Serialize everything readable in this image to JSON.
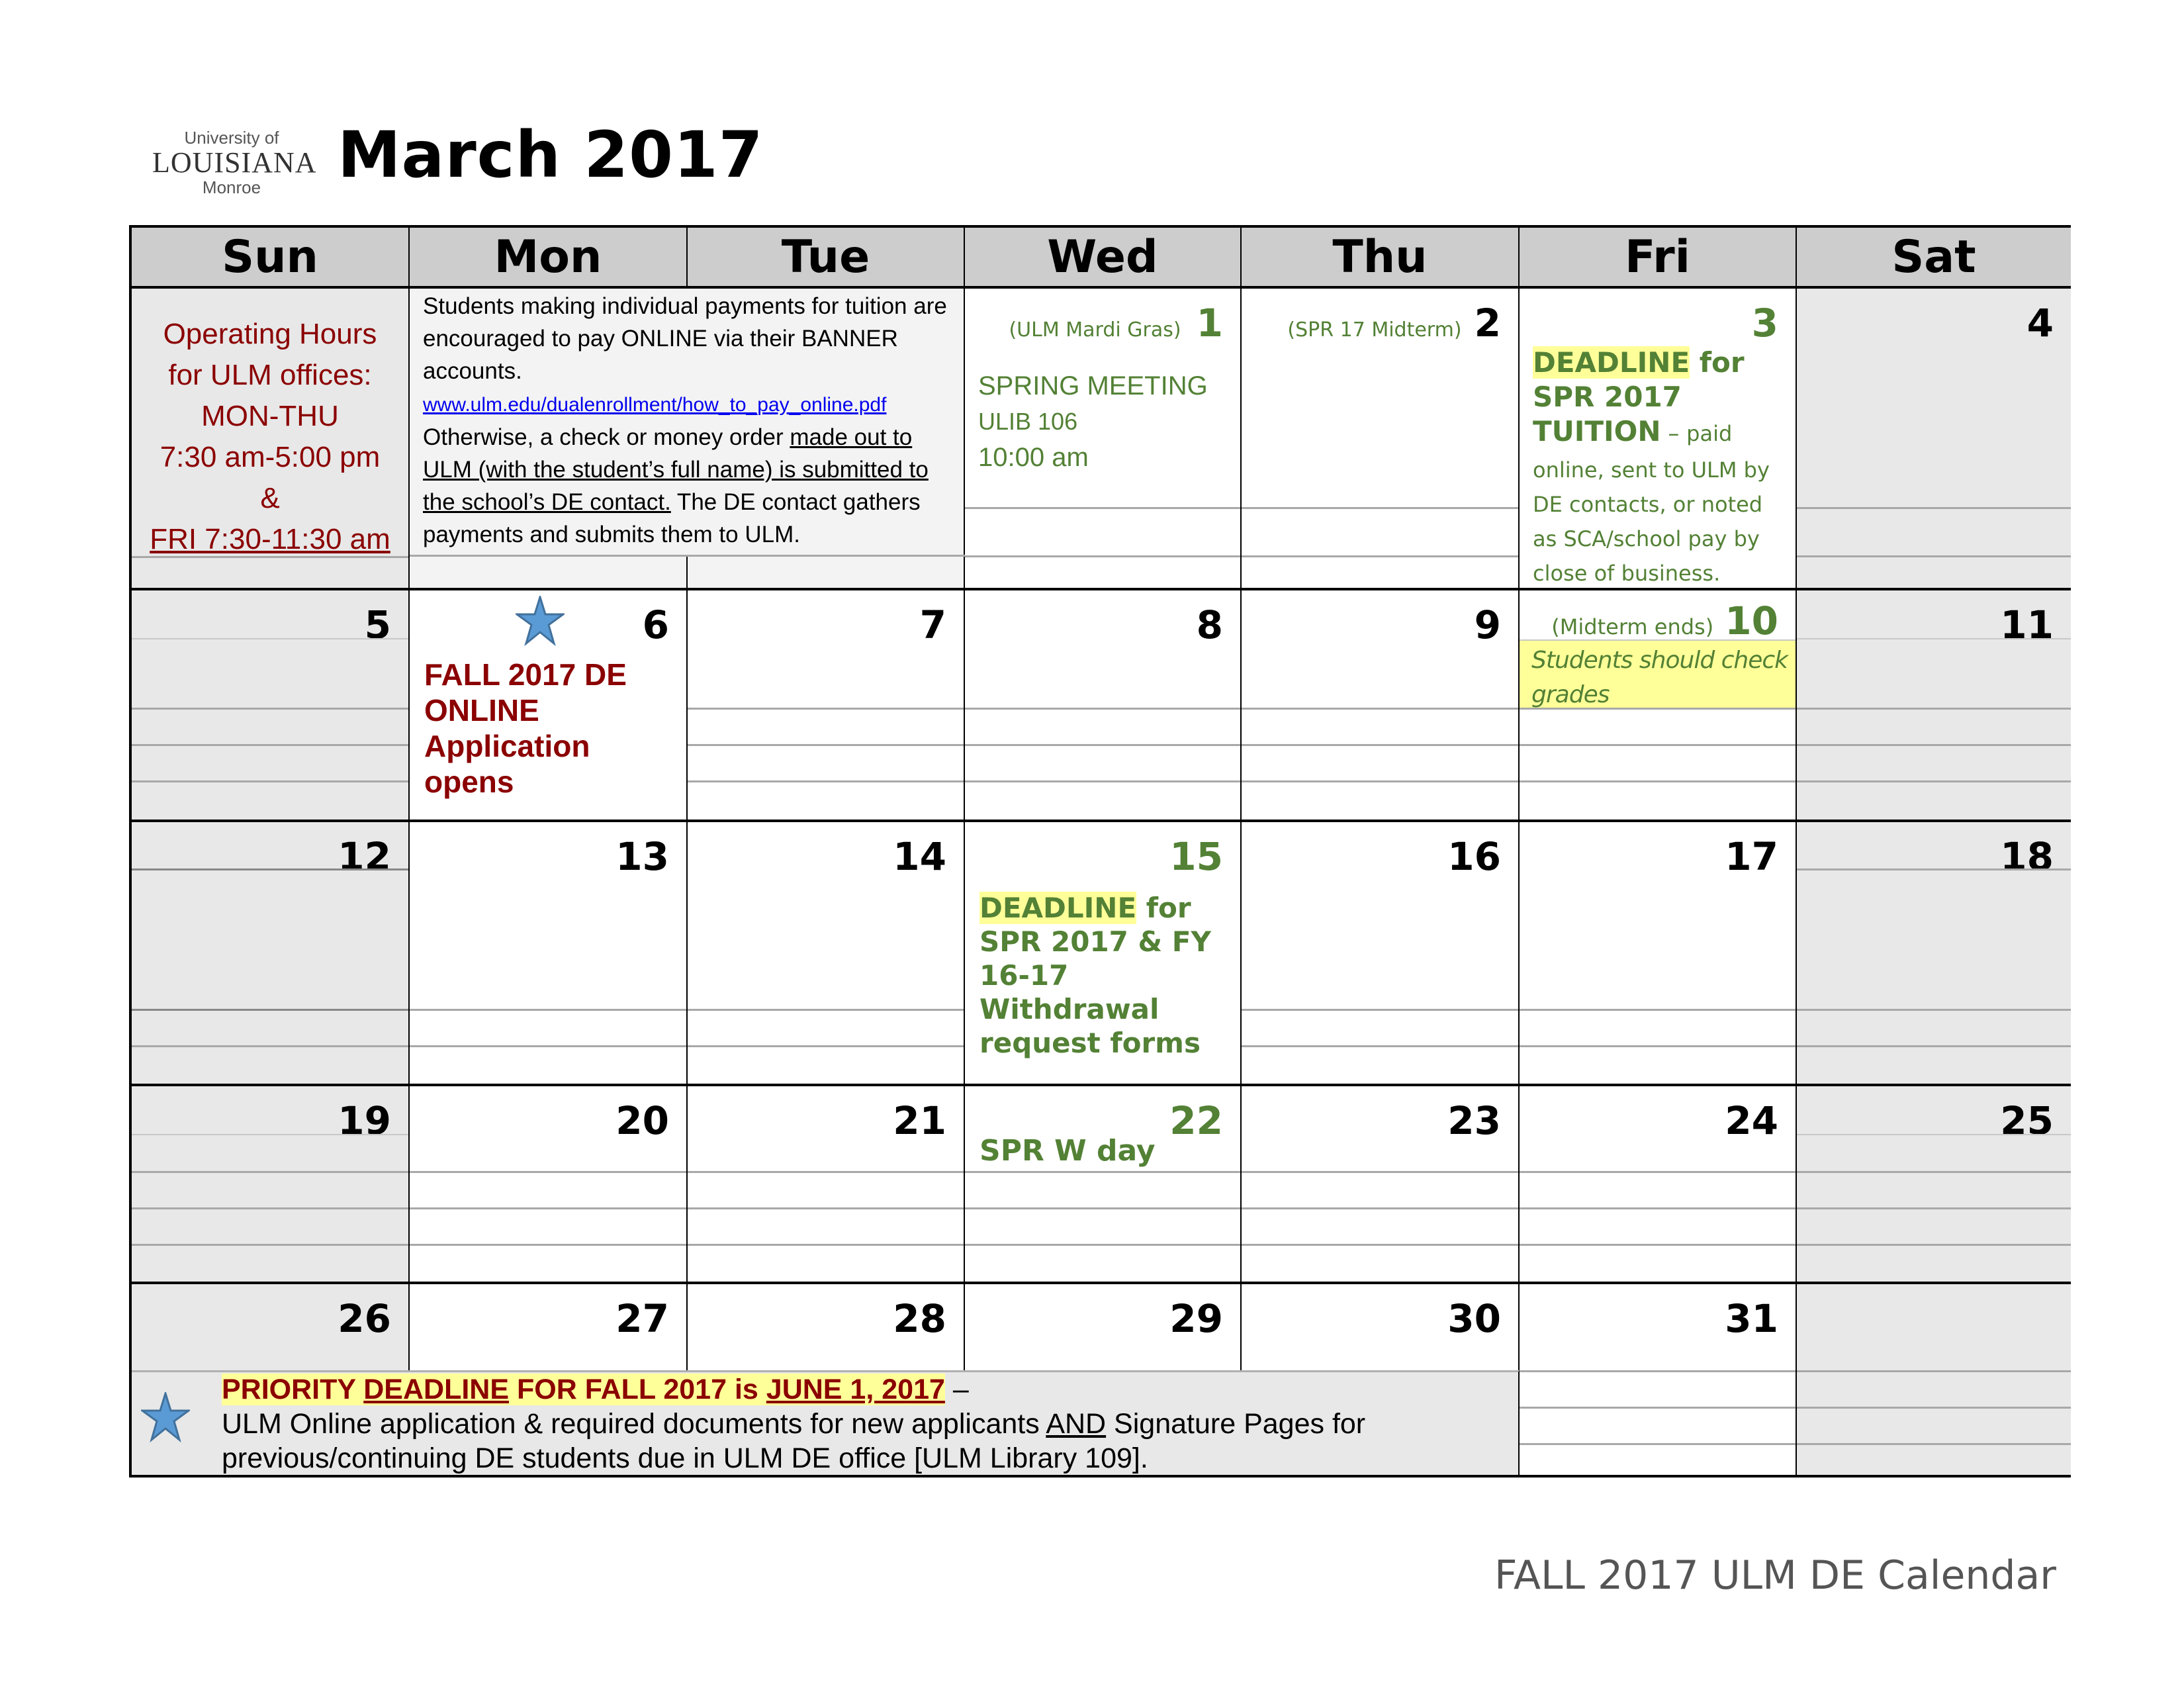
{
  "logo": {
    "line1": "University of",
    "line2": "LOUISIANA",
    "line3": "Monroe"
  },
  "title": "March 2017",
  "footer": "FALL 2017 ULM DE Calendar",
  "days": [
    "Sun",
    "Mon",
    "Tue",
    "Wed",
    "Thu",
    "Fri",
    "Sat"
  ],
  "week1": {
    "sun_hours": [
      "Operating Hours",
      "for ULM offices:",
      "MON-THU",
      "7:30 am-5:00 pm",
      "&",
      "FRI 7:30-11:30 am"
    ],
    "payment_note": {
      "p1": "Students making individual payments for tuition are encouraged to pay ONLINE via their BANNER accounts.",
      "link": "www.ulm.edu/dualenrollment/how_to_pay_online.pdf",
      "p2a": "Otherwise, a check or money order ",
      "p2u": "made out to ULM (with the student’s full name) is submitted to the school’s DE contact.",
      "p2b": "  The DE contact gathers payments and submits them to ULM."
    },
    "wed": {
      "num": "1",
      "label": "(ULM Mardi Gras)",
      "event": [
        "SPRING MEETING",
        "ULIB 106",
        "10:00 am"
      ]
    },
    "thu": {
      "num": "2",
      "label": "(SPR 17 Midterm)"
    },
    "fri": {
      "num": "3",
      "deadline": "DEADLINE",
      "for": " for",
      "bold2": "SPR 2017 TUITION",
      "dash": " – ",
      "rest": "paid online, sent to ULM by DE contacts, or noted as SCA/school pay by close of business."
    },
    "sat": {
      "num": "4"
    }
  },
  "week2": {
    "nums": [
      "5",
      "6",
      "7",
      "8",
      "9",
      "10",
      "11"
    ],
    "mon_event": "FALL 2017 DE ONLINE Application opens",
    "fri_label": "(Midterm ends)",
    "fri_note": "Students should check grades"
  },
  "week3": {
    "nums": [
      "12",
      "13",
      "14",
      "15",
      "16",
      "17",
      "18"
    ],
    "wed_deadline": "DEADLINE",
    "wed_rest": " for SPR 2017 & FY 16-17 Withdrawal request forms"
  },
  "week4": {
    "nums": [
      "19",
      "20",
      "21",
      "22",
      "23",
      "24",
      "25"
    ],
    "wed_event": "SPR W day"
  },
  "week5": {
    "nums": [
      "26",
      "27",
      "28",
      "29",
      "30",
      "31"
    ],
    "priority": {
      "a": "PRIORITY ",
      "b": "DEADLINE",
      "c": " FOR FALL 2017 is ",
      "d": "JUNE 1, 2017",
      "e": " –"
    },
    "line2a": "ULM Online application & required documents for new applicants ",
    "line2u": "AND",
    "line2b": " Signature Pages for previous/continuing DE students due in ULM DE office [ULM Library 109]."
  },
  "colors": {
    "green": "#538135",
    "dark_red": "#8b0000",
    "highlight": "#ffff99",
    "header_gray": "#cdcdcd",
    "weekend_gray": "#e8e8e8",
    "star_blue": "#5b9bd5"
  }
}
